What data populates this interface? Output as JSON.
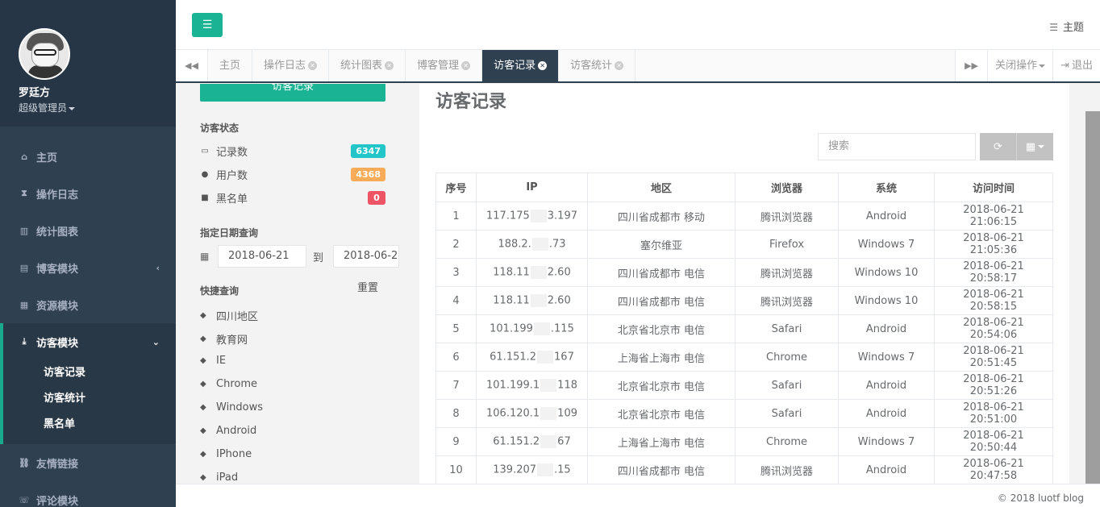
{
  "user": {
    "name": "罗廷方",
    "role": "超级管理员"
  },
  "sidebar": {
    "items": [
      {
        "label": "主页",
        "icon": "home-icon"
      },
      {
        "label": "操作日志",
        "icon": "hourglass-icon"
      },
      {
        "label": "统计图表",
        "icon": "bar-chart-icon"
      },
      {
        "label": "博客模块",
        "icon": "book-icon"
      },
      {
        "label": "资源模块",
        "icon": "grid-icon"
      },
      {
        "label": "访客模块",
        "icon": "download-icon"
      },
      {
        "label": "友情链接",
        "icon": "link-icon"
      },
      {
        "label": "评论模块",
        "icon": "comment-icon"
      }
    ],
    "subitems": [
      "访客记录",
      "访客统计",
      "黑名单"
    ]
  },
  "header": {
    "theme_label": "主题"
  },
  "tabs": {
    "items": [
      "主页",
      "操作日志",
      "统计图表",
      "博客管理",
      "访客记录",
      "访客统计"
    ],
    "close_ops": "关闭操作",
    "logout": "退出"
  },
  "filter": {
    "top_button": "访客记录",
    "status_title": "访客状态",
    "stats": [
      {
        "label": "记录数",
        "value": "6347",
        "color": "#23c6c8"
      },
      {
        "label": "用户数",
        "value": "4368",
        "color": "#f8ac59"
      },
      {
        "label": "黑名单",
        "value": "0",
        "color": "#ed5565"
      }
    ],
    "date_title": "指定日期查询",
    "date_from": "2018-06-21",
    "date_sep": "到",
    "date_to": "2018-06-2",
    "reset": "重置",
    "quick_title": "快捷查询",
    "quick": [
      "四川地区",
      "教育网",
      "IE",
      "Chrome",
      "Windows",
      "Android",
      "IPhone",
      "iPad"
    ]
  },
  "main": {
    "title": "访客记录",
    "search_placeholder": "搜索",
    "columns": [
      "序号",
      "IP",
      "地区",
      "浏览器",
      "系统",
      "访问时间"
    ],
    "rows": [
      {
        "idx": "1",
        "ip_a": "117.175",
        "ip_b": "3.197",
        "region": "四川省成都市 移动",
        "browser": "腾讯浏览器",
        "os": "Android",
        "time": "2018-06-21 21:06:15"
      },
      {
        "idx": "2",
        "ip_a": "188.2.",
        "ip_b": ".73",
        "region": "塞尔维亚",
        "browser": "Firefox",
        "os": "Windows 7",
        "time": "2018-06-21 21:05:36"
      },
      {
        "idx": "3",
        "ip_a": "118.11",
        "ip_b": "2.60",
        "region": "四川省成都市 电信",
        "browser": "腾讯浏览器",
        "os": "Windows 10",
        "time": "2018-06-21 20:58:17"
      },
      {
        "idx": "4",
        "ip_a": "118.11",
        "ip_b": "2.60",
        "region": "四川省成都市 电信",
        "browser": "腾讯浏览器",
        "os": "Windows 10",
        "time": "2018-06-21 20:58:15"
      },
      {
        "idx": "5",
        "ip_a": "101.199",
        "ip_b": ".115",
        "region": "北京省北京市 电信",
        "browser": "Safari",
        "os": "Android",
        "time": "2018-06-21 20:54:06"
      },
      {
        "idx": "6",
        "ip_a": "61.151.2",
        "ip_b": "167",
        "region": "上海省上海市 电信",
        "browser": "Chrome",
        "os": "Windows 7",
        "time": "2018-06-21 20:51:45"
      },
      {
        "idx": "7",
        "ip_a": "101.199.1",
        "ip_b": "118",
        "region": "北京省北京市 电信",
        "browser": "Safari",
        "os": "Android",
        "time": "2018-06-21 20:51:26"
      },
      {
        "idx": "8",
        "ip_a": "106.120.1",
        "ip_b": "109",
        "region": "北京省北京市 电信",
        "browser": "Safari",
        "os": "Android",
        "time": "2018-06-21 20:51:00"
      },
      {
        "idx": "9",
        "ip_a": "61.151.2",
        "ip_b": "67",
        "region": "上海省上海市 电信",
        "browser": "Chrome",
        "os": "Windows 7",
        "time": "2018-06-21 20:50:44"
      },
      {
        "idx": "10",
        "ip_a": "139.207",
        "ip_b": ".15",
        "region": "四川省成都市 电信",
        "browser": "腾讯浏览器",
        "os": "Android",
        "time": "2018-06-21 20:47:58"
      }
    ]
  },
  "footer": {
    "text": "© 2018 luotf blog"
  }
}
